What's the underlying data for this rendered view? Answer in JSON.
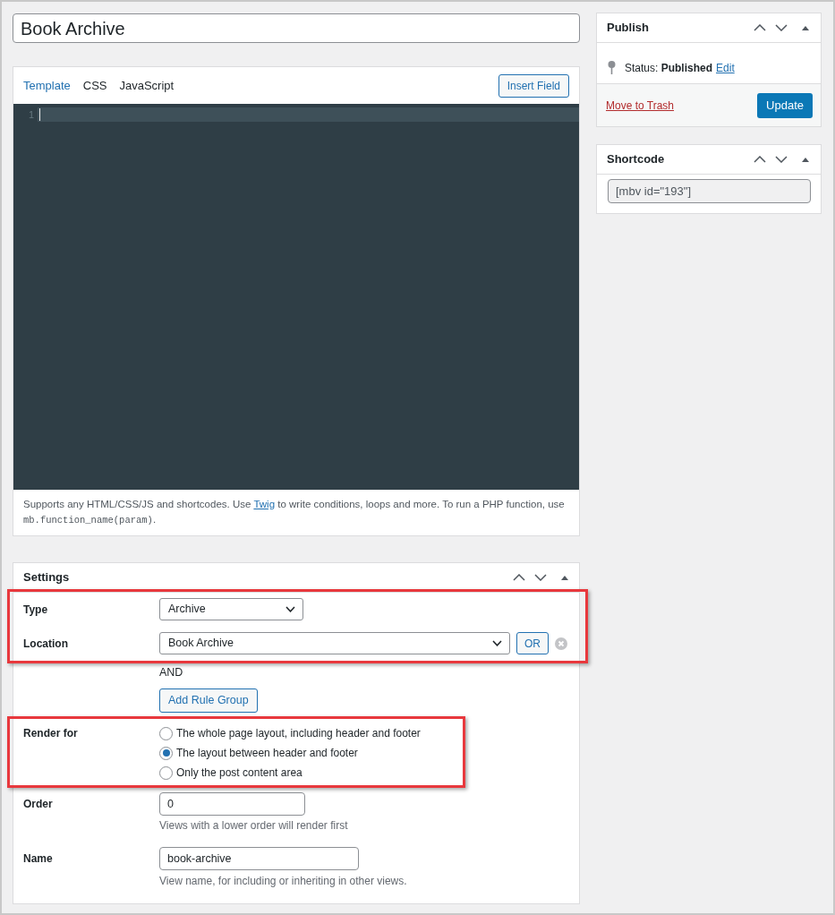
{
  "title_field": {
    "value": "Book Archive"
  },
  "editor": {
    "tabs": [
      {
        "label": "Template",
        "selected": true
      },
      {
        "label": "CSS",
        "selected": false
      },
      {
        "label": "JavaScript",
        "selected": false
      }
    ],
    "insert_button": "Insert Field",
    "line_numbers": [
      "1"
    ],
    "help": {
      "before": "Supports any HTML/CSS/JS and shortcodes. Use ",
      "link": "Twig",
      "middle": " to write conditions, loops and more. To run a PHP function, use ",
      "code": "mb.function_name(param)",
      "after": "."
    }
  },
  "settings": {
    "title": "Settings",
    "type": {
      "label": "Type",
      "value": "Archive"
    },
    "location": {
      "label": "Location",
      "value": "Book Archive",
      "or_button": "OR"
    },
    "and_label": "AND",
    "add_rule_button": "Add Rule Group",
    "render_for": {
      "label": "Render for",
      "options": [
        {
          "label": "The whole page layout, including header and footer",
          "selected": false
        },
        {
          "label": "The layout between header and footer",
          "selected": true
        },
        {
          "label": "Only the post content area",
          "selected": false
        }
      ]
    },
    "order": {
      "label": "Order",
      "value": "0",
      "hint": "Views with a lower order will render first"
    },
    "name": {
      "label": "Name",
      "value": "book-archive",
      "hint": "View name, for including or inheriting in other views."
    }
  },
  "publish": {
    "title": "Publish",
    "status": "Status: **Published**",
    "edit_link": "Edit",
    "trash_link": "Move to Trash",
    "update_button": "Update"
  },
  "shortcode": {
    "title": "Shortcode",
    "value": "[mbv id=\"193\"]"
  }
}
